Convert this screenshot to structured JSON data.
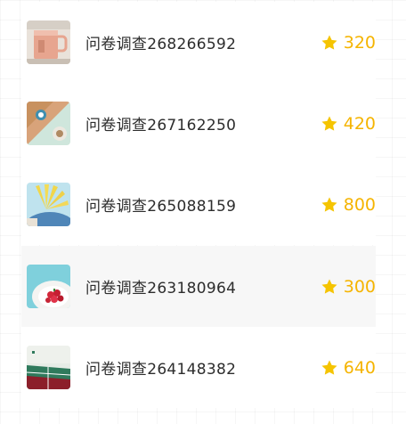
{
  "accent_color": "#f5b400",
  "surveys": [
    {
      "title": "问卷调查268266592",
      "points": "320",
      "thumb_icon": "pink-mug-thumbnail"
    },
    {
      "title": "问卷调查267162250",
      "points": "420",
      "thumb_icon": "coffee-table-thumbnail"
    },
    {
      "title": "问卷调查265088159",
      "points": "800",
      "thumb_icon": "yellow-fan-thumbnail"
    },
    {
      "title": "问卷调查263180964",
      "points": "300",
      "thumb_icon": "strawberry-plate-thumbnail"
    },
    {
      "title": "问卷调查264148382",
      "points": "640",
      "thumb_icon": "tennis-court-thumbnail"
    }
  ],
  "selected_index": 3
}
